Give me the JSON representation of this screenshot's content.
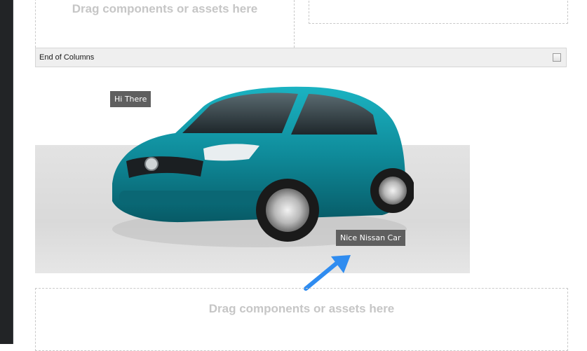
{
  "layout_columns": {
    "left_drop_label": "Drag components or assets here"
  },
  "end_columns": {
    "label": "End of Columns",
    "checkbox_checked": false
  },
  "image_component": {
    "icon": "car-image",
    "hotspots": [
      {
        "label": "Hi There"
      },
      {
        "label": "Nice Nissan Car"
      }
    ],
    "car_color": "#0f8b9a",
    "band_color": "#dedede"
  },
  "callout_arrow": {
    "icon": "arrow-icon",
    "color": "#2f8cf0"
  },
  "bottom_drop_zone": {
    "label": "Drag components or assets here"
  },
  "colors": {
    "rail": "#222426",
    "tooltip_bg": "#5f5f5f",
    "placeholder_text": "#c6c6c6"
  }
}
